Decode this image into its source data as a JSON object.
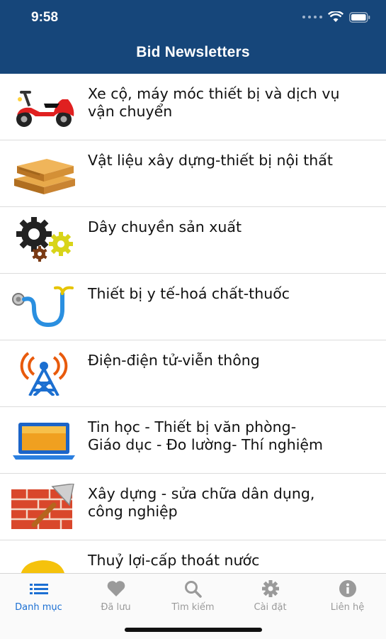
{
  "status": {
    "time": "9:58"
  },
  "nav": {
    "title": "Bid Newsletters"
  },
  "categories": [
    {
      "label": "Xe cộ, máy móc thiết bị và dịch vụ\nvận chuyển",
      "icon": "scooter-icon"
    },
    {
      "label": "Vật liệu xây dựng-thiết bị nội thất",
      "icon": "lumber-icon"
    },
    {
      "label": "Dây chuyền sản xuất",
      "icon": "gears-icon"
    },
    {
      "label": "Thiết bị y tế-hoá chất-thuốc",
      "icon": "stethoscope-icon"
    },
    {
      "label": "Điện-điện tử-viễn thông",
      "icon": "antenna-tower-icon"
    },
    {
      "label": "Tin học - Thiết bị văn phòng-\nGiáo dục - Đo lường-  Thí nghiệm",
      "icon": "laptop-icon"
    },
    {
      "label": "Xây dựng - sửa chữa dân dụng,\ncông nghiệp",
      "icon": "brick-trowel-icon"
    },
    {
      "label": "Thuỷ lợi-cấp thoát nước",
      "icon": "worker-helmet-icon"
    }
  ],
  "tabs": [
    {
      "label": "Danh mục",
      "icon": "list-icon",
      "active": true
    },
    {
      "label": "Đã lưu",
      "icon": "heart-icon",
      "active": false
    },
    {
      "label": "Tìm kiếm",
      "icon": "search-icon",
      "active": false
    },
    {
      "label": "Cài đặt",
      "icon": "gear-icon",
      "active": false
    },
    {
      "label": "Liên hệ",
      "icon": "info-icon",
      "active": false
    }
  ],
  "colors": {
    "header": "#16467a",
    "tab_active": "#1b6fd3",
    "tab_inactive": "#9a9a9a"
  }
}
